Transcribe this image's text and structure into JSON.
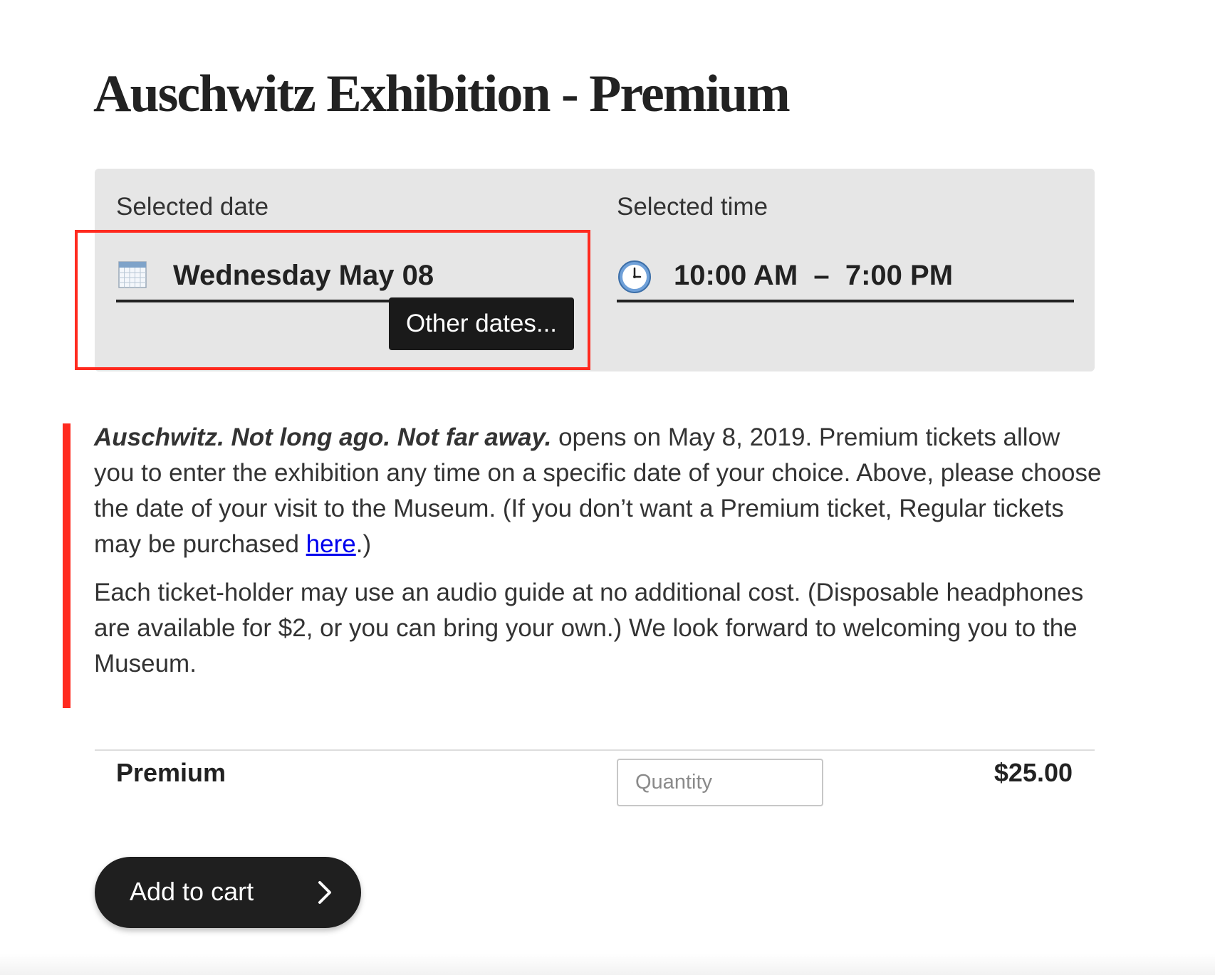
{
  "page": {
    "title": "Auschwitz Exhibition - Premium"
  },
  "selection": {
    "date_label": "Selected date",
    "date_value": "Wednesday May 08",
    "date_icon": "calendar-icon",
    "other_dates_label": "Other dates...",
    "time_label": "Selected time",
    "time_value": "10:00 AM  –  7:00 PM",
    "time_icon": "clock-icon"
  },
  "description": {
    "p1_exhibit": "Auschwitz. Not long ago. Not far away.",
    "p1_text": " opens on May 8, 2019. Premium tickets allow you to enter the exhibition any time on a specific date of your choice. Above, please choose the date of your visit to the Museum. (If you don’t want a Premium ticket, Regular tickets may be purchased ",
    "p1_link": "here",
    "p1_end": ".)",
    "p2": "Each ticket-holder may use an audio guide at no additional cost. (Disposable headphones are available for $2, or you can bring your own.) We look forward to welcoming you to the Museum."
  },
  "ticket": {
    "name": "Premium",
    "quantity_value": "",
    "quantity_placeholder": "Quantity",
    "price": "$25.00"
  },
  "cart": {
    "add_label": "Add to cart"
  },
  "colors": {
    "highlight": "#ff2a1f",
    "panel_background": "#e6e6e6",
    "button_dark": "#1f1f1f",
    "link": "#0000ee"
  }
}
